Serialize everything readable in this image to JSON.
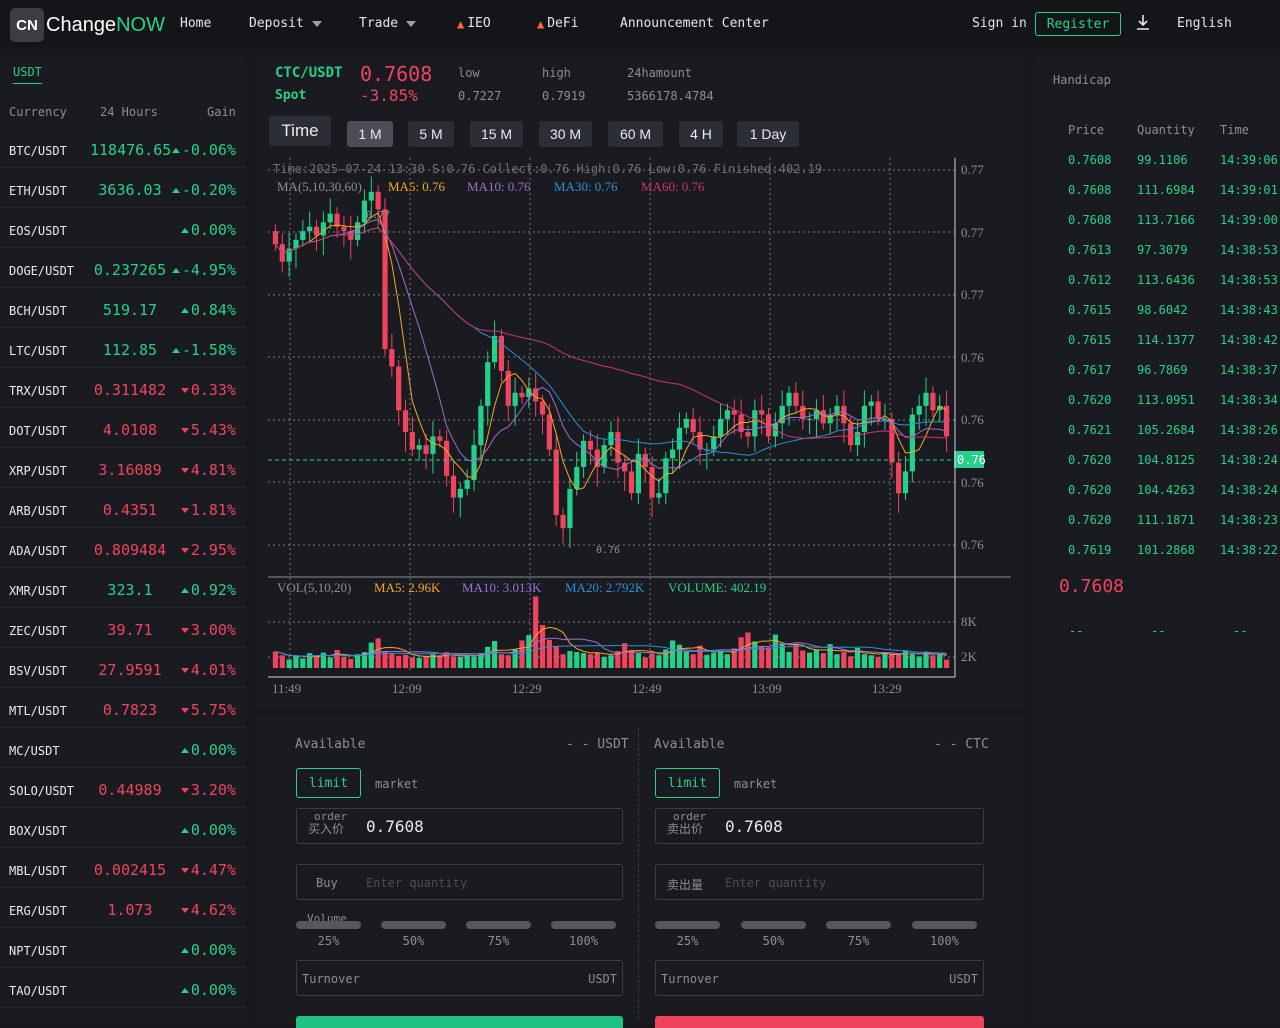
{
  "header": {
    "logo_icon": "CN",
    "logo_text_a": "Change",
    "logo_text_b": "NOW",
    "nav": [
      "Home",
      "Deposit",
      "Trade",
      "IEO",
      "DeFi",
      "Announcement Center"
    ],
    "sign_in": "Sign in",
    "register": "Register",
    "download_icon": "download-arrow-icon",
    "language": "English"
  },
  "market": {
    "tab": "USDT",
    "columns": [
      "Currency",
      "24 Hours",
      "Gain"
    ],
    "rows": [
      {
        "sym": "BTC/USDT",
        "price": "118476.65",
        "gain": "-0.06%",
        "dir": "up"
      },
      {
        "sym": "ETH/USDT",
        "price": "3636.03",
        "gain": "-0.20%",
        "dir": "up"
      },
      {
        "sym": "EOS/USDT",
        "price": "",
        "gain": "0.00%",
        "dir": "up"
      },
      {
        "sym": "DOGE/USDT",
        "price": "0.237265",
        "gain": "-4.95%",
        "dir": "up"
      },
      {
        "sym": "BCH/USDT",
        "price": "519.17",
        "gain": "0.84%",
        "dir": "up"
      },
      {
        "sym": "LTC/USDT",
        "price": "112.85",
        "gain": "-1.58%",
        "dir": "up"
      },
      {
        "sym": "TRX/USDT",
        "price": "0.311482",
        "gain": "0.33%",
        "dir": "down"
      },
      {
        "sym": "DOT/USDT",
        "price": "4.0108",
        "gain": "5.43%",
        "dir": "down"
      },
      {
        "sym": "XRP/USDT",
        "price": "3.16089",
        "gain": "4.81%",
        "dir": "down"
      },
      {
        "sym": "ARB/USDT",
        "price": "0.4351",
        "gain": "1.81%",
        "dir": "down"
      },
      {
        "sym": "ADA/USDT",
        "price": "0.809484",
        "gain": "2.95%",
        "dir": "down"
      },
      {
        "sym": "XMR/USDT",
        "price": "323.1",
        "gain": "0.92%",
        "dir": "up"
      },
      {
        "sym": "ZEC/USDT",
        "price": "39.71",
        "gain": "3.00%",
        "dir": "down"
      },
      {
        "sym": "BSV/USDT",
        "price": "27.9591",
        "gain": "4.01%",
        "dir": "down"
      },
      {
        "sym": "MTL/USDT",
        "price": "0.7823",
        "gain": "5.75%",
        "dir": "down"
      },
      {
        "sym": "MC/USDT",
        "price": "",
        "gain": "0.00%",
        "dir": "up"
      },
      {
        "sym": "SOLO/USDT",
        "price": "0.44989",
        "gain": "3.20%",
        "dir": "down"
      },
      {
        "sym": "BOX/USDT",
        "price": "",
        "gain": "0.00%",
        "dir": "up"
      },
      {
        "sym": "MBL/USDT",
        "price": "0.002415",
        "gain": "4.47%",
        "dir": "down"
      },
      {
        "sym": "ERG/USDT",
        "price": "1.073",
        "gain": "4.62%",
        "dir": "down"
      },
      {
        "sym": "NPT/USDT",
        "price": "",
        "gain": "0.00%",
        "dir": "up"
      },
      {
        "sym": "TAO/USDT",
        "price": "",
        "gain": "0.00%",
        "dir": "up"
      }
    ]
  },
  "ticker": {
    "pair": "CTC/USDT",
    "type": "Spot",
    "price": "0.7608",
    "change": "-3.85%",
    "low_label": "low",
    "low": "0.7227",
    "high_label": "high",
    "high": "0.7919",
    "amount_label": "24hamount",
    "amount": "5366178.4784"
  },
  "timeframes": [
    "Time",
    "1 M",
    "5 M",
    "15 M",
    "30 M",
    "60 M",
    "4 H",
    "1 Day"
  ],
  "active_timeframe": "1 M",
  "chart_info": {
    "ohlc_line": "Time:2025-07-24 13:30   S:0.76   Collect:0.76   High:0.76   Low:0.76  Finished:402.19",
    "ma_title": "MA(5,10,30,60)",
    "ma5": "MA5: 0.76",
    "ma10": "MA10: 0.76",
    "ma30": "MA30: 0.76",
    "ma60": "MA60: 0.76",
    "hi_mark": "0.77",
    "lo_mark": "0.76",
    "current_tag": "0.76",
    "vol_title": "VOL(5,10,20)",
    "vol_ma5": "MA5: 2.96K",
    "vol_ma10": "MA10: 3.013K",
    "vol_ma20": "MA20: 2.792K",
    "volume": "VOLUME: 402.19"
  },
  "chart_data": {
    "type": "candlestick",
    "price_axis_ticks": [
      "0.77",
      "0.77",
      "0.77",
      "0.76",
      "0.76",
      "0.76",
      "0.76"
    ],
    "volume_axis_ticks": [
      "8K",
      "2K"
    ],
    "time_ticks": [
      "11:49",
      "12:09",
      "12:29",
      "12:49",
      "13:09",
      "13:29"
    ],
    "close_series": [
      0.7668,
      0.7664,
      0.7667,
      0.7669,
      0.7671,
      0.7672,
      0.767,
      0.7673,
      0.7675,
      0.7672,
      0.7671,
      0.7669,
      0.7673,
      0.7678,
      0.768,
      0.7676,
      0.7644,
      0.764,
      0.763,
      0.7625,
      0.7621,
      0.7622,
      0.762,
      0.7624,
      0.7623,
      0.7615,
      0.761,
      0.7612,
      0.7614,
      0.7622,
      0.7631,
      0.7641,
      0.7647,
      0.7639,
      0.7631,
      0.7634,
      0.7633,
      0.7635,
      0.7632,
      0.7629,
      0.7621,
      0.7606,
      0.7603,
      0.7612,
      0.7617,
      0.7623,
      0.7621,
      0.7617,
      0.7622,
      0.7625,
      0.7618,
      0.7616,
      0.7611,
      0.762,
      0.7617,
      0.761,
      0.7611,
      0.7619,
      0.7621,
      0.7626,
      0.7628,
      0.7625,
      0.7621,
      0.7621,
      0.7624,
      0.7628,
      0.763,
      0.7629,
      0.7625,
      0.7624,
      0.763,
      0.7629,
      0.7624,
      0.7627,
      0.7631,
      0.7634,
      0.7631,
      0.7628,
      0.7628,
      0.763,
      0.7627,
      0.7629,
      0.7631,
      0.7627,
      0.7622,
      0.7625,
      0.7631,
      0.7632,
      0.7628,
      0.7628,
      0.7618,
      0.7611,
      0.7616,
      0.7629,
      0.7631,
      0.7634,
      0.763,
      0.7631,
      0.7624
    ],
    "volume_series": [
      3.1,
      2.4,
      1.6,
      2.2,
      1.8,
      2.8,
      2.3,
      2.9,
      2.0,
      3.4,
      2.1,
      1.7,
      2.6,
      3.0,
      4.8,
      5.6,
      3.2,
      2.7,
      2.3,
      2.5,
      2.0,
      1.9,
      2.2,
      2.6,
      2.4,
      3.0,
      2.2,
      2.1,
      2.5,
      2.2,
      2.8,
      4.0,
      5.1,
      2.6,
      2.4,
      3.6,
      5.2,
      6.2,
      13.5,
      8.1,
      5.3,
      4.1,
      2.6,
      3.2,
      3.0,
      2.8,
      2.6,
      2.9,
      2.1,
      2.4,
      3.2,
      4.7,
      3.4,
      2.8,
      2.0,
      2.7,
      2.4,
      3.5,
      5.2,
      4.4,
      3.2,
      2.6,
      4.2,
      2.5,
      2.9,
      3.3,
      2.6,
      3.7,
      5.8,
      6.7,
      5.0,
      4.1,
      3.9,
      6.3,
      4.6,
      3.0,
      4.5,
      3.3,
      2.9,
      3.5,
      2.8,
      4.5,
      2.6,
      3.0,
      2.2,
      3.8,
      2.6,
      2.4,
      2.1,
      3.0,
      2.7,
      2.5,
      3.3,
      2.6,
      2.2,
      3.1,
      2.4,
      2.7,
      1.6
    ]
  },
  "orderbook": {
    "title": "Handicap",
    "columns": [
      "Price",
      "Quantity",
      "Time"
    ],
    "rows": [
      [
        "0.7608",
        "99.1106",
        "14:39:06"
      ],
      [
        "0.7608",
        "111.6984",
        "14:39:01"
      ],
      [
        "0.7608",
        "113.7166",
        "14:39:00"
      ],
      [
        "0.7613",
        "97.3079",
        "14:38:53"
      ],
      [
        "0.7612",
        "113.6436",
        "14:38:53"
      ],
      [
        "0.7615",
        "98.6042",
        "14:38:43"
      ],
      [
        "0.7615",
        "114.1377",
        "14:38:42"
      ],
      [
        "0.7617",
        "96.7869",
        "14:38:37"
      ],
      [
        "0.7620",
        "113.0951",
        "14:38:34"
      ],
      [
        "0.7621",
        "105.2684",
        "14:38:26"
      ],
      [
        "0.7620",
        "104.8125",
        "14:38:24"
      ],
      [
        "0.7620",
        "104.4263",
        "14:38:24"
      ],
      [
        "0.7620",
        "111.1871",
        "14:38:23"
      ],
      [
        "0.7619",
        "101.2868",
        "14:38:22"
      ]
    ],
    "last_price": "0.7608",
    "dashes": [
      "--",
      "--",
      "--"
    ]
  },
  "trade": {
    "buy": {
      "available_label": "Available",
      "available_value": "- - USDT",
      "limit": "limit",
      "market": "market",
      "price_caption": "买入价",
      "price_caption_top": "order",
      "price_value": "0.7608",
      "qty_caption": "Buy",
      "qty_placeholder": "Enter quantity",
      "volume_label": "Volume",
      "percents": [
        "25%",
        "50%",
        "75%",
        "100%"
      ],
      "turnover": "Turnover",
      "unit": "USDT"
    },
    "sell": {
      "available_label": "Available",
      "available_value": "- - CTC",
      "limit": "limit",
      "market": "market",
      "price_caption": "卖出价",
      "price_caption_top": "order",
      "price_value": "0.7608",
      "qty_caption": "卖出量",
      "qty_placeholder": "Enter quantity",
      "percents": [
        "25%",
        "50%",
        "75%",
        "100%"
      ],
      "turnover": "Turnover",
      "unit": "USDT"
    }
  },
  "colors": {
    "up": "#24d18b",
    "down": "#f0445e",
    "ma5": "#f5a623",
    "ma10": "#9b6fd1",
    "ma30": "#2d8fd8",
    "ma60": "#d0346e"
  }
}
